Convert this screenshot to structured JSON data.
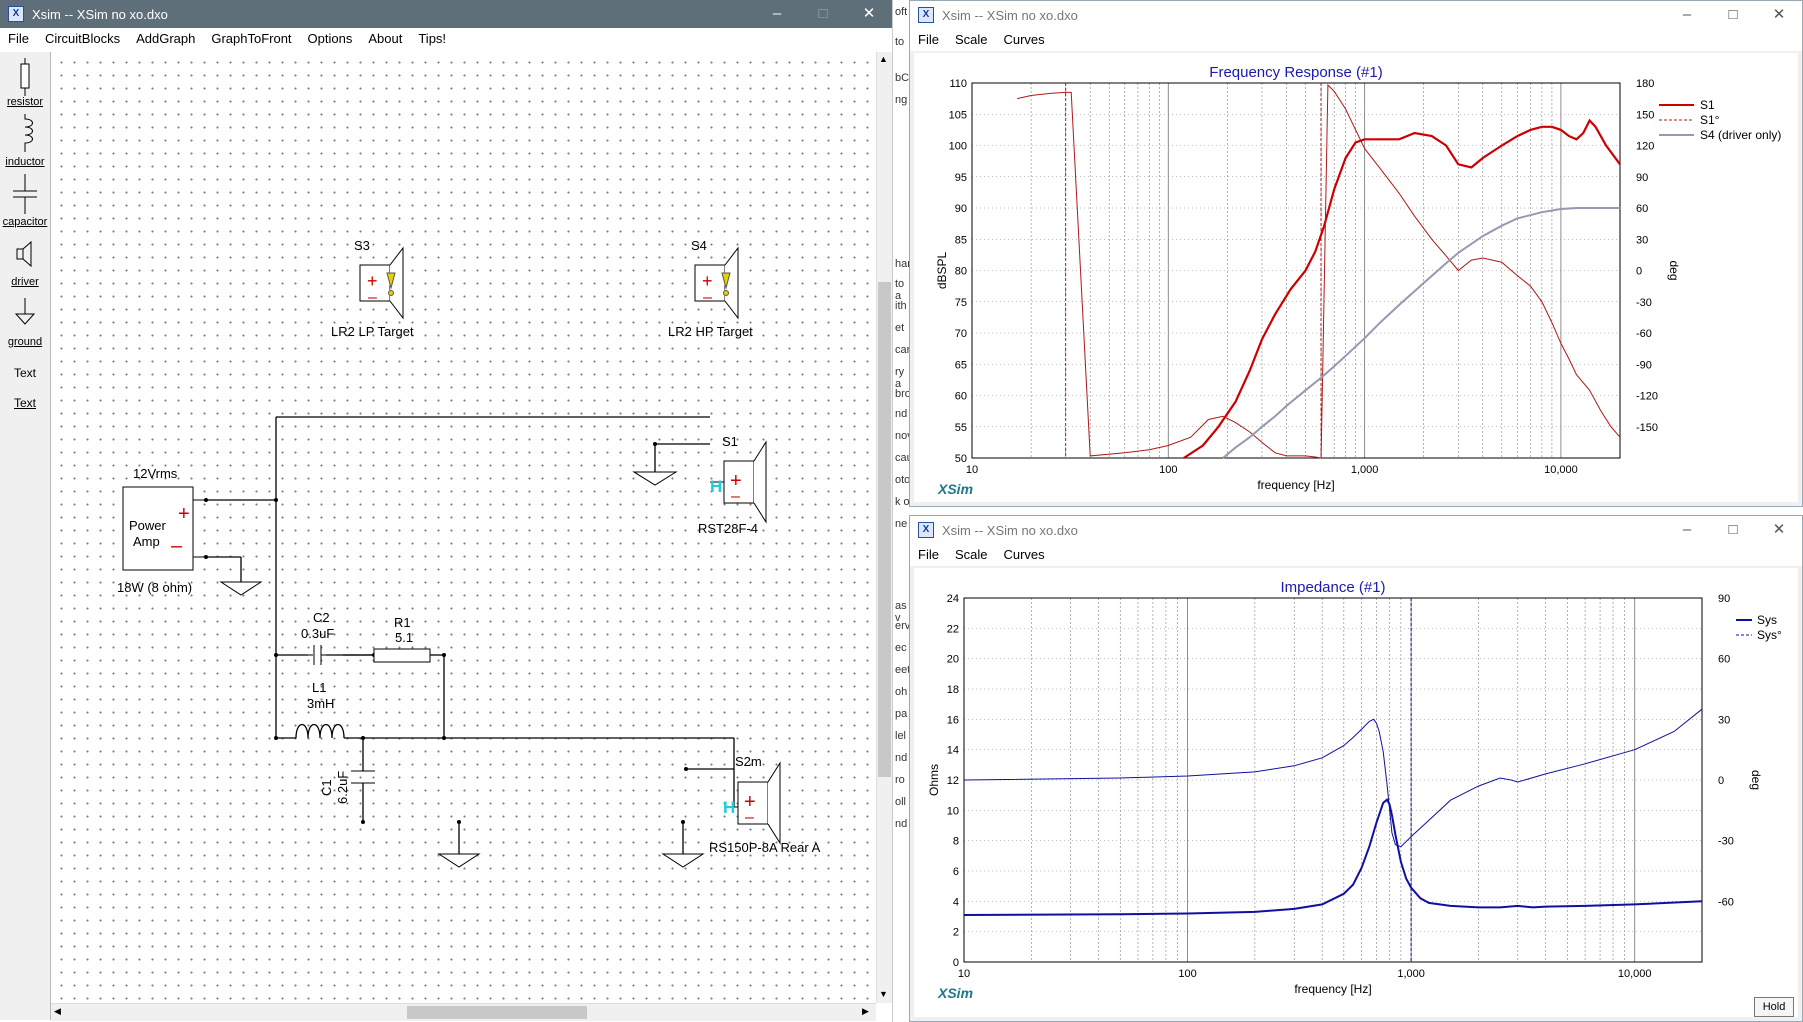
{
  "main_window": {
    "title": "Xsim -- XSim no xo.dxo",
    "menu": [
      "File",
      "CircuitBlocks",
      "AddGraph",
      "GraphToFront",
      "Options",
      "About",
      "Tips!"
    ],
    "toolbox": [
      "resistor",
      "inductor",
      "capacitor",
      "driver",
      "ground",
      "Text",
      "Text"
    ]
  },
  "schematic": {
    "source": {
      "top": "12Vrms",
      "line1": "Power",
      "line2": "Amp",
      "bottom": "18W (8 ohm)"
    },
    "S3": {
      "name": "S3",
      "label": "LR2 LP Target"
    },
    "S4": {
      "name": "S4",
      "label": "LR2 HP Target"
    },
    "S1": {
      "name": "S1",
      "label": "RST28F-4"
    },
    "S2": {
      "name": "S2m",
      "label": "RS150P-8A Rear A"
    },
    "C2": {
      "name": "C2",
      "value": "0.3uF"
    },
    "R1": {
      "name": "R1",
      "value": "5.1"
    },
    "L1": {
      "name": "L1",
      "value": "3mH"
    },
    "C1": {
      "name": "C1",
      "value": "6.2uF"
    }
  },
  "bg_window_fragments": [
    "oft",
    "to",
    "bC",
    "ng",
    "har",
    "to a",
    "ith",
    "et",
    "car",
    "ry a",
    "bro",
    "nd",
    "nov",
    "cau",
    "oto",
    "k o",
    "ne",
    "as v",
    "erv",
    "ec",
    "eet",
    "oh",
    "pa",
    "lel",
    "nd",
    "ro",
    "oll",
    "nd"
  ],
  "freq_window": {
    "title": "Xsim -- XSim no xo.dxo",
    "menu": [
      "File",
      "Scale",
      "Curves"
    ],
    "logo": "XSim",
    "chart_data": {
      "type": "line",
      "title": "Frequency Response (#1)",
      "xlabel": "frequency [Hz]",
      "ylabel": "dBSPL",
      "y2label": "deg",
      "xscale": "log",
      "xlim": [
        10,
        20000
      ],
      "ylim": [
        50,
        110
      ],
      "y2lim": [
        -180,
        180
      ],
      "xticks": [
        "10",
        "100",
        "1,000",
        "10,000"
      ],
      "yticks": [
        "50",
        "55",
        "60",
        "65",
        "70",
        "75",
        "80",
        "85",
        "90",
        "95",
        "100",
        "105",
        "110"
      ],
      "y2ticks": [
        "-150",
        "-120",
        "-90",
        "-60",
        "-30",
        "0",
        "30",
        "60",
        "90",
        "120",
        "150",
        "180"
      ],
      "legend": [
        "S1",
        "S1°",
        "S4 (driver only)"
      ],
      "legend_position": "right",
      "colors": {
        "S1": "#cc0000",
        "S1_phase": "#b01818",
        "S4": "#9898b0",
        "title": "#1a1ab0",
        "grid": "#808080"
      },
      "series": [
        {
          "name": "S1",
          "axis": "left",
          "x": [
            120,
            150,
            180,
            220,
            260,
            300,
            350,
            420,
            500,
            560,
            620,
            700,
            800,
            900,
            1000,
            1200,
            1500,
            1800,
            2200,
            2600,
            3000,
            3500,
            4000,
            5000,
            6000,
            7000,
            8000,
            9000,
            10000,
            11000,
            12000,
            13000,
            14000,
            15000,
            17000,
            20000
          ],
          "y": [
            50,
            52,
            55,
            59,
            64,
            69,
            73,
            77,
            80,
            83,
            87,
            93,
            98,
            100.5,
            101,
            101,
            101,
            102,
            101.5,
            100,
            97,
            96.5,
            98,
            100,
            101.5,
            102.5,
            103,
            103,
            102.5,
            101.5,
            101,
            102,
            104,
            103,
            100,
            97
          ]
        },
        {
          "name": "S1°",
          "axis": "right",
          "x": [
            17,
            20,
            25,
            30,
            32,
            40,
            60,
            80,
            100,
            130,
            160,
            190,
            220,
            260,
            300,
            350,
            400,
            450,
            500,
            560,
            600,
            650,
            700,
            800,
            900,
            1000,
            1200,
            1500,
            1800,
            2200,
            2600,
            3000,
            3500,
            4000,
            5000,
            6000,
            7000,
            8000,
            9000,
            10000,
            11000,
            12000,
            14000,
            16000,
            18000,
            20000
          ],
          "y": [
            165,
            168,
            170,
            171,
            171,
            -178,
            -175,
            -172,
            -168,
            -160,
            -143,
            -140,
            -146,
            -155,
            -165,
            -175,
            -178,
            -178,
            -178,
            -179,
            -180,
            178,
            172,
            155,
            135,
            117,
            98,
            74,
            52,
            30,
            14,
            0,
            10,
            12,
            8,
            -5,
            -15,
            -30,
            -50,
            -70,
            -85,
            -100,
            -115,
            -135,
            -150,
            -160
          ]
        },
        {
          "name": "S4 (driver only)",
          "axis": "right",
          "x": [
            190,
            220,
            260,
            300,
            350,
            400,
            500,
            600,
            700,
            800,
            1000,
            1200,
            1500,
            2000,
            2500,
            3000,
            4000,
            5000,
            6000,
            8000,
            10000,
            12000,
            15000,
            20000
          ],
          "y": [
            -180,
            -170,
            -160,
            -150,
            -140,
            -130,
            -115,
            -103,
            -92,
            -82,
            -65,
            -50,
            -33,
            -12,
            4,
            17,
            33,
            43,
            50,
            56,
            59,
            60,
            60,
            60
          ]
        }
      ],
      "markers_hz": [
        30,
        600
      ]
    }
  },
  "imp_window": {
    "title": "Xsim -- XSim no xo.dxo",
    "menu": [
      "File",
      "Scale",
      "Curves"
    ],
    "logo": "XSim",
    "hold_label": "Hold",
    "chart_data": {
      "type": "line",
      "title": "Impedance (#1)",
      "xlabel": "frequency [Hz]",
      "ylabel": "Ohms",
      "y2label": "deg",
      "xscale": "log",
      "xlim": [
        10,
        20000
      ],
      "ylim": [
        0,
        24
      ],
      "y2lim": [
        -90,
        90
      ],
      "xticks": [
        "10",
        "100",
        "1,000",
        "10,000"
      ],
      "yticks": [
        "0",
        "2",
        "4",
        "6",
        "8",
        "10",
        "12",
        "14",
        "16",
        "18",
        "20",
        "22",
        "24"
      ],
      "y2ticks": [
        "-60",
        "-30",
        "0",
        "30",
        "60",
        "90"
      ],
      "legend": [
        "Sys",
        "Sys°"
      ],
      "legend_position": "right",
      "colors": {
        "line": "#1010a0",
        "title": "#1a1ab0",
        "grid": "#808080"
      },
      "series": [
        {
          "name": "Sys",
          "axis": "left",
          "x": [
            10,
            50,
            100,
            200,
            300,
            400,
            500,
            550,
            600,
            650,
            700,
            750,
            780,
            800,
            820,
            850,
            900,
            950,
            1000,
            1100,
            1200,
            1500,
            2000,
            2500,
            3000,
            3500,
            4000,
            6000,
            10000,
            20000
          ],
          "y": [
            3.1,
            3.15,
            3.2,
            3.3,
            3.5,
            3.8,
            4.5,
            5.1,
            6.2,
            7.6,
            9.2,
            10.5,
            10.7,
            10.4,
            9.7,
            8.4,
            6.6,
            5.5,
            4.9,
            4.2,
            3.9,
            3.7,
            3.6,
            3.6,
            3.7,
            3.6,
            3.65,
            3.7,
            3.8,
            4.0
          ]
        },
        {
          "name": "Sys°",
          "axis": "right",
          "x": [
            10,
            50,
            100,
            200,
            300,
            400,
            500,
            550,
            600,
            650,
            680,
            700,
            720,
            750,
            780,
            800,
            820,
            850,
            900,
            1000,
            1200,
            1500,
            2000,
            2500,
            2800,
            3000,
            4000,
            6000,
            10000,
            15000,
            20000
          ],
          "y": [
            0,
            1,
            2,
            4,
            7,
            11,
            17,
            21,
            25,
            29,
            30,
            28,
            24,
            14,
            -2,
            -14,
            -26,
            -32,
            -33,
            -28,
            -20,
            -10,
            -3,
            1,
            0,
            -1,
            3,
            8,
            15,
            24,
            35
          ]
        }
      ],
      "markers_hz": [
        1000
      ]
    }
  }
}
